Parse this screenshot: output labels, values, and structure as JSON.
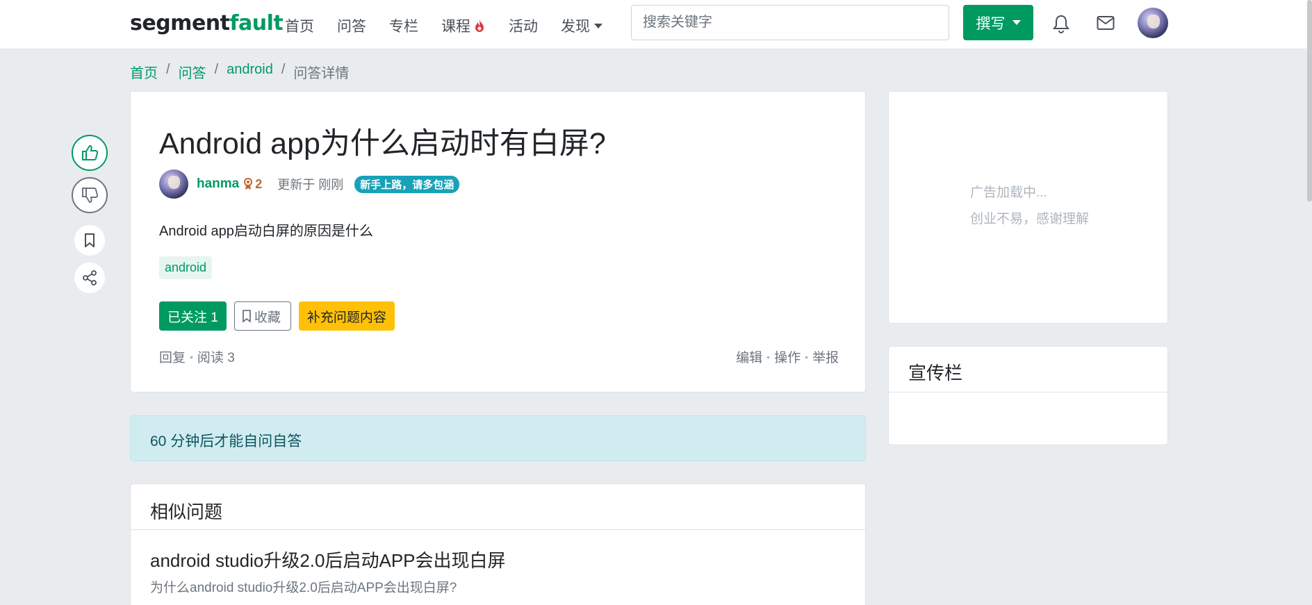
{
  "navbar": {
    "logo_part1": "segment",
    "logo_part2": "fault",
    "items": [
      {
        "label": "首页"
      },
      {
        "label": "问答"
      },
      {
        "label": "专栏"
      },
      {
        "label": "课程",
        "icon": "fire-icon"
      },
      {
        "label": "活动"
      },
      {
        "label": "发现",
        "icon": "chevron-down-icon"
      }
    ],
    "search_placeholder": "搜索关键字",
    "write_label": "撰写"
  },
  "breadcrumb": [
    "首页",
    "问答",
    "android",
    "问答详情"
  ],
  "question": {
    "title": "Android app为什么启动时有白屏?",
    "author": "hanma",
    "reputation": "2",
    "updated": "更新于 刚刚",
    "badge": "新手上路，请多包涵",
    "body": "Android app启动白屏的原因是什么",
    "tag": "android",
    "follow_label": "已关注 1",
    "collect_label": "收藏",
    "supplement_label": "补充问题内容",
    "meta_left": [
      "回复",
      "阅读 3"
    ],
    "meta_right": [
      "编辑",
      "操作",
      "举报"
    ]
  },
  "alert_text": "60 分钟后才能自问自答",
  "similar": {
    "heading": "相似问题",
    "items": [
      {
        "title": "android studio升级2.0后启动APP会出现白屏",
        "desc": "为什么android studio升级2.0后启动APP会出现白屏?"
      }
    ]
  },
  "sidebar": {
    "ad_line1": "广告加载中...",
    "ad_line2": "创业不易，感谢理解",
    "promo_heading": "宣传栏"
  },
  "colors": {
    "brand": "#009a61",
    "warning": "#ffc107",
    "info_bg": "#d1ecf1",
    "badge": "#17a2b8"
  }
}
